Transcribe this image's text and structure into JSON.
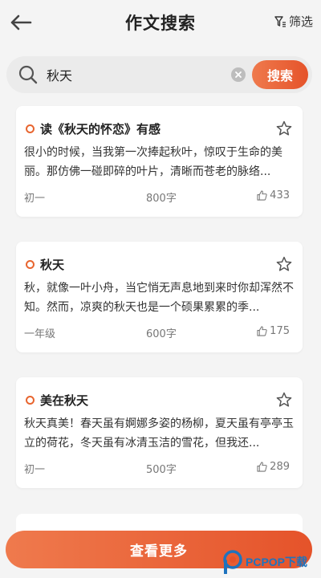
{
  "header": {
    "title": "作文搜索",
    "filter_label": "筛选",
    "back_icon": "arrow-left-icon",
    "filter_icon": "filter-icon"
  },
  "search": {
    "value": "秋天",
    "placeholder": "",
    "button_label": "搜索",
    "search_icon": "search-icon",
    "clear_icon": "clear-icon"
  },
  "results": [
    {
      "title": "读《秋天的怀恋》有感",
      "excerpt": "很小的时候，当我第一次捧起秋叶，惊叹于生命的美丽。那仿佛一碰即碎的叶片，清晰而苍老的脉络...",
      "grade": "初一",
      "words": "800字",
      "likes": "433"
    },
    {
      "title": "秋天",
      "excerpt": "秋，就像一叶小舟，当它悄无声息地到来时你却浑然不知。然而，凉爽的秋天也是一个硕果累累的季...",
      "grade": "一年级",
      "words": "600字",
      "likes": "175"
    },
    {
      "title": "美在秋天",
      "excerpt": "秋天真美！春天虽有婀娜多姿的杨柳，夏天虽有亭亭玉立的荷花，冬天虽有冰清玉洁的雪花，但我还...",
      "grade": "初一",
      "words": "500字",
      "likes": "289"
    }
  ],
  "footer": {
    "more_label": "查看更多"
  },
  "watermark": {
    "text": "PCPOP下载"
  },
  "colors": {
    "accent": "#e8652f",
    "accent_light": "#ef7a4d",
    "background": "#f4f4f4"
  }
}
